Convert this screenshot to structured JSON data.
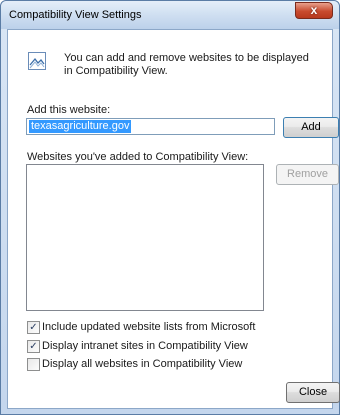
{
  "window": {
    "title": "Compatibility View Settings",
    "close_label": "x"
  },
  "info": {
    "icon": "compat-view-icon",
    "text": "You can add and remove websites to be displayed in Compatibility View."
  },
  "add_site": {
    "label": "Add this website:",
    "value": "texasagriculture.gov",
    "button": "Add"
  },
  "site_list": {
    "label": "Websites you've added to Compatibility View:",
    "items": [],
    "remove_button": "Remove"
  },
  "options": [
    {
      "label": "Include updated website lists from Microsoft",
      "checked": true
    },
    {
      "label": "Display intranet sites in Compatibility View",
      "checked": true
    },
    {
      "label": "Display all websites in Compatibility View",
      "checked": false
    }
  ],
  "footer": {
    "close_button": "Close"
  },
  "colors": {
    "selection": "#3399ff",
    "close_button_red": "#c84b2f",
    "title_gradient": "#cfdff1"
  }
}
